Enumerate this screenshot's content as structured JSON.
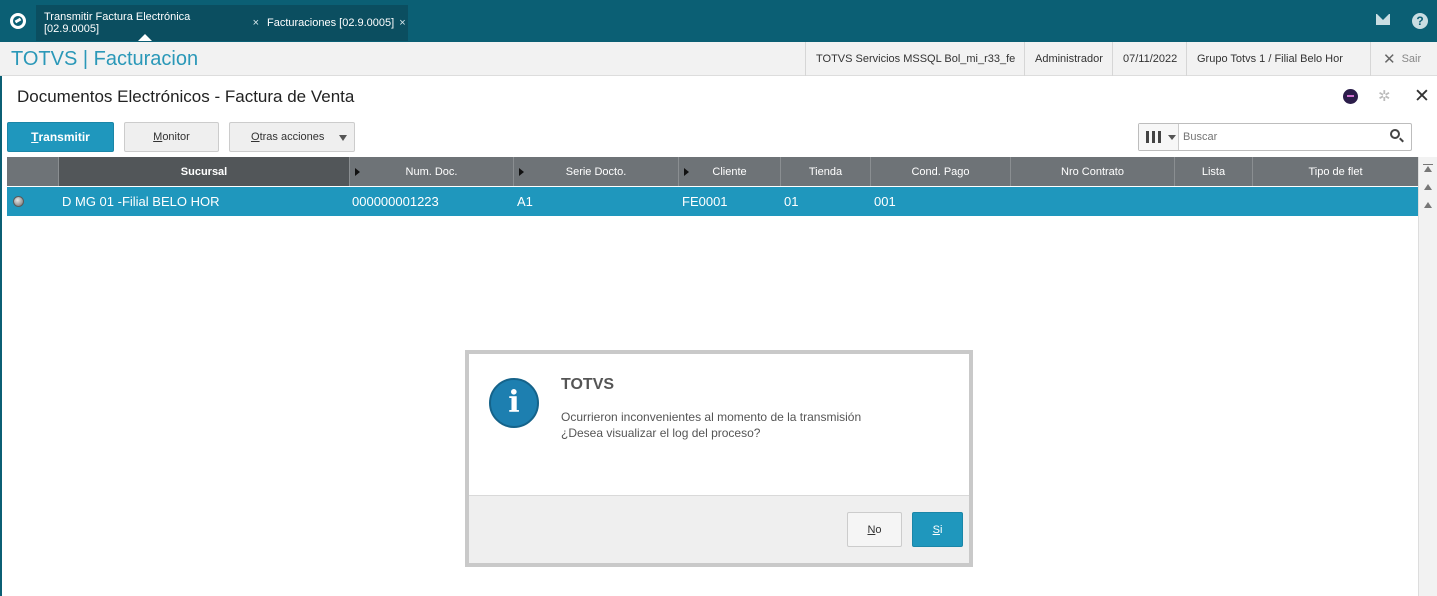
{
  "tabs": [
    {
      "label": "Transmitir Factura Electrónica [02.9.0005]"
    },
    {
      "label": "Facturaciones [02.9.0005]"
    }
  ],
  "tab_close_glyph": "×",
  "topbar_icons": [
    "totvs-logo-icon",
    "mail-icon",
    "help-icon"
  ],
  "help_glyph": "?",
  "header": {
    "title": "TOTVS | Facturacion",
    "environment": "TOTVS Servicios MSSQL Bol_mi_r33_fe",
    "user": "Administrador",
    "date": "07/11/2022",
    "branch": "Grupo Totvs 1 / Filial Belo Hor",
    "exit_glyph": "✕",
    "exit_label": "Sair"
  },
  "page": {
    "title": "Documentos Electrónicos - Factura de Venta",
    "gear_glyph": "✲",
    "close_glyph": "✕"
  },
  "toolbar": {
    "transmit_first": "T",
    "transmit_rest": "ransmitir",
    "monitor_first": "M",
    "monitor_rest": "onitor",
    "other_first": "O",
    "other_rest": "tras acciones"
  },
  "search": {
    "placeholder": "Buscar"
  },
  "grid": {
    "columns": [
      "Sucursal",
      "Num. Doc.",
      "Serie Docto.",
      "Cliente",
      "Tienda",
      "Cond. Pago",
      "Nro Contrato",
      "Lista",
      "Tipo de flet"
    ],
    "rows": [
      [
        "D MG 01 -Filial BELO HOR",
        "000000001223",
        "A1",
        "FE0001",
        "01",
        "001",
        "",
        "",
        ""
      ]
    ]
  },
  "dialog": {
    "icon_glyph": "i",
    "title": "TOTVS",
    "message_line1": "Ocurrieron inconvenientes al momento de la transmisión",
    "message_line2": "¿Desea visualizar el log del proceso?",
    "no_first": "N",
    "no_rest": "o",
    "yes_first": "S",
    "yes_rest": "i"
  },
  "colors": {
    "topbar": "#0b5f74",
    "accent": "#1f97bd",
    "header_title": "#2a98b8",
    "grid_header": "#6e7377"
  }
}
